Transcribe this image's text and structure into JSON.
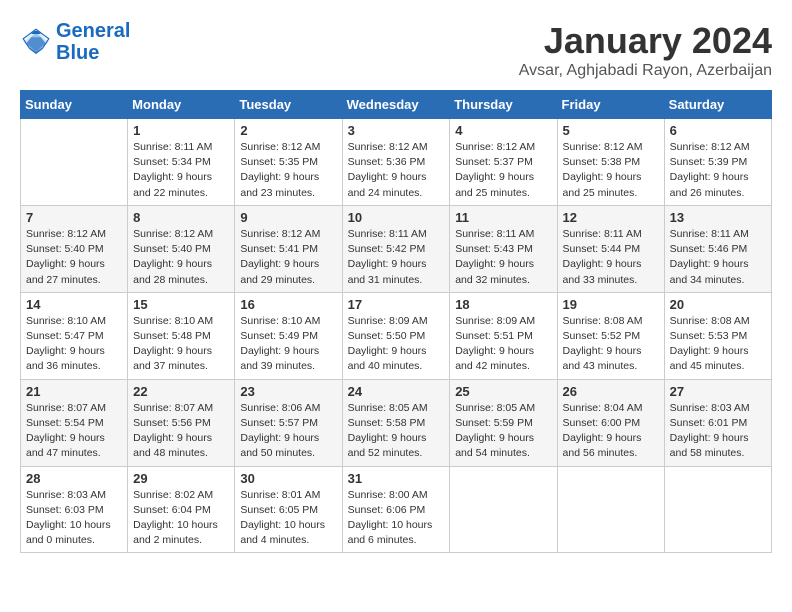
{
  "logo": {
    "line1": "General",
    "line2": "Blue"
  },
  "title": "January 2024",
  "location": "Avsar, Aghjabadi Rayon, Azerbaijan",
  "header_days": [
    "Sunday",
    "Monday",
    "Tuesday",
    "Wednesday",
    "Thursday",
    "Friday",
    "Saturday"
  ],
  "weeks": [
    [
      {
        "day": "",
        "sunrise": "",
        "sunset": "",
        "daylight": ""
      },
      {
        "day": "1",
        "sunrise": "Sunrise: 8:11 AM",
        "sunset": "Sunset: 5:34 PM",
        "daylight": "Daylight: 9 hours and 22 minutes."
      },
      {
        "day": "2",
        "sunrise": "Sunrise: 8:12 AM",
        "sunset": "Sunset: 5:35 PM",
        "daylight": "Daylight: 9 hours and 23 minutes."
      },
      {
        "day": "3",
        "sunrise": "Sunrise: 8:12 AM",
        "sunset": "Sunset: 5:36 PM",
        "daylight": "Daylight: 9 hours and 24 minutes."
      },
      {
        "day": "4",
        "sunrise": "Sunrise: 8:12 AM",
        "sunset": "Sunset: 5:37 PM",
        "daylight": "Daylight: 9 hours and 25 minutes."
      },
      {
        "day": "5",
        "sunrise": "Sunrise: 8:12 AM",
        "sunset": "Sunset: 5:38 PM",
        "daylight": "Daylight: 9 hours and 25 minutes."
      },
      {
        "day": "6",
        "sunrise": "Sunrise: 8:12 AM",
        "sunset": "Sunset: 5:39 PM",
        "daylight": "Daylight: 9 hours and 26 minutes."
      }
    ],
    [
      {
        "day": "7",
        "sunrise": "Sunrise: 8:12 AM",
        "sunset": "Sunset: 5:40 PM",
        "daylight": "Daylight: 9 hours and 27 minutes."
      },
      {
        "day": "8",
        "sunrise": "Sunrise: 8:12 AM",
        "sunset": "Sunset: 5:40 PM",
        "daylight": "Daylight: 9 hours and 28 minutes."
      },
      {
        "day": "9",
        "sunrise": "Sunrise: 8:12 AM",
        "sunset": "Sunset: 5:41 PM",
        "daylight": "Daylight: 9 hours and 29 minutes."
      },
      {
        "day": "10",
        "sunrise": "Sunrise: 8:11 AM",
        "sunset": "Sunset: 5:42 PM",
        "daylight": "Daylight: 9 hours and 31 minutes."
      },
      {
        "day": "11",
        "sunrise": "Sunrise: 8:11 AM",
        "sunset": "Sunset: 5:43 PM",
        "daylight": "Daylight: 9 hours and 32 minutes."
      },
      {
        "day": "12",
        "sunrise": "Sunrise: 8:11 AM",
        "sunset": "Sunset: 5:44 PM",
        "daylight": "Daylight: 9 hours and 33 minutes."
      },
      {
        "day": "13",
        "sunrise": "Sunrise: 8:11 AM",
        "sunset": "Sunset: 5:46 PM",
        "daylight": "Daylight: 9 hours and 34 minutes."
      }
    ],
    [
      {
        "day": "14",
        "sunrise": "Sunrise: 8:10 AM",
        "sunset": "Sunset: 5:47 PM",
        "daylight": "Daylight: 9 hours and 36 minutes."
      },
      {
        "day": "15",
        "sunrise": "Sunrise: 8:10 AM",
        "sunset": "Sunset: 5:48 PM",
        "daylight": "Daylight: 9 hours and 37 minutes."
      },
      {
        "day": "16",
        "sunrise": "Sunrise: 8:10 AM",
        "sunset": "Sunset: 5:49 PM",
        "daylight": "Daylight: 9 hours and 39 minutes."
      },
      {
        "day": "17",
        "sunrise": "Sunrise: 8:09 AM",
        "sunset": "Sunset: 5:50 PM",
        "daylight": "Daylight: 9 hours and 40 minutes."
      },
      {
        "day": "18",
        "sunrise": "Sunrise: 8:09 AM",
        "sunset": "Sunset: 5:51 PM",
        "daylight": "Daylight: 9 hours and 42 minutes."
      },
      {
        "day": "19",
        "sunrise": "Sunrise: 8:08 AM",
        "sunset": "Sunset: 5:52 PM",
        "daylight": "Daylight: 9 hours and 43 minutes."
      },
      {
        "day": "20",
        "sunrise": "Sunrise: 8:08 AM",
        "sunset": "Sunset: 5:53 PM",
        "daylight": "Daylight: 9 hours and 45 minutes."
      }
    ],
    [
      {
        "day": "21",
        "sunrise": "Sunrise: 8:07 AM",
        "sunset": "Sunset: 5:54 PM",
        "daylight": "Daylight: 9 hours and 47 minutes."
      },
      {
        "day": "22",
        "sunrise": "Sunrise: 8:07 AM",
        "sunset": "Sunset: 5:56 PM",
        "daylight": "Daylight: 9 hours and 48 minutes."
      },
      {
        "day": "23",
        "sunrise": "Sunrise: 8:06 AM",
        "sunset": "Sunset: 5:57 PM",
        "daylight": "Daylight: 9 hours and 50 minutes."
      },
      {
        "day": "24",
        "sunrise": "Sunrise: 8:05 AM",
        "sunset": "Sunset: 5:58 PM",
        "daylight": "Daylight: 9 hours and 52 minutes."
      },
      {
        "day": "25",
        "sunrise": "Sunrise: 8:05 AM",
        "sunset": "Sunset: 5:59 PM",
        "daylight": "Daylight: 9 hours and 54 minutes."
      },
      {
        "day": "26",
        "sunrise": "Sunrise: 8:04 AM",
        "sunset": "Sunset: 6:00 PM",
        "daylight": "Daylight: 9 hours and 56 minutes."
      },
      {
        "day": "27",
        "sunrise": "Sunrise: 8:03 AM",
        "sunset": "Sunset: 6:01 PM",
        "daylight": "Daylight: 9 hours and 58 minutes."
      }
    ],
    [
      {
        "day": "28",
        "sunrise": "Sunrise: 8:03 AM",
        "sunset": "Sunset: 6:03 PM",
        "daylight": "Daylight: 10 hours and 0 minutes."
      },
      {
        "day": "29",
        "sunrise": "Sunrise: 8:02 AM",
        "sunset": "Sunset: 6:04 PM",
        "daylight": "Daylight: 10 hours and 2 minutes."
      },
      {
        "day": "30",
        "sunrise": "Sunrise: 8:01 AM",
        "sunset": "Sunset: 6:05 PM",
        "daylight": "Daylight: 10 hours and 4 minutes."
      },
      {
        "day": "31",
        "sunrise": "Sunrise: 8:00 AM",
        "sunset": "Sunset: 6:06 PM",
        "daylight": "Daylight: 10 hours and 6 minutes."
      },
      {
        "day": "",
        "sunrise": "",
        "sunset": "",
        "daylight": ""
      },
      {
        "day": "",
        "sunrise": "",
        "sunset": "",
        "daylight": ""
      },
      {
        "day": "",
        "sunrise": "",
        "sunset": "",
        "daylight": ""
      }
    ]
  ]
}
